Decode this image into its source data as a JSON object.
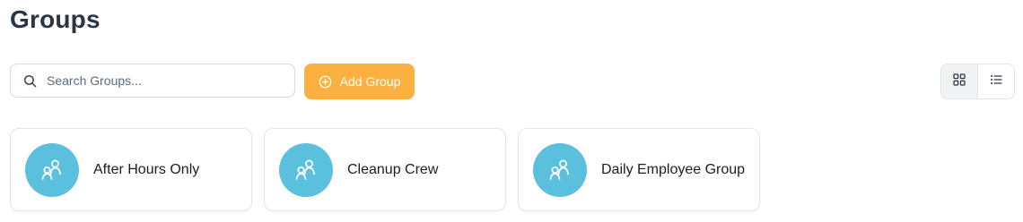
{
  "header": {
    "title": "Groups"
  },
  "toolbar": {
    "search_placeholder": "Search Groups...",
    "search_value": "",
    "add_label": "Add Group",
    "view_modes": [
      {
        "name": "grid",
        "icon": "grid-icon",
        "active": true
      },
      {
        "name": "list",
        "icon": "list-icon",
        "active": false
      }
    ]
  },
  "groups": [
    {
      "name": "After Hours Only",
      "icon": "group-icon"
    },
    {
      "name": "Cleanup Crew",
      "icon": "group-icon"
    },
    {
      "name": "Daily Employee Group",
      "icon": "group-icon"
    }
  ],
  "colors": {
    "accent": "#fbb040",
    "avatar": "#5bc0de",
    "title": "#2b3545"
  }
}
